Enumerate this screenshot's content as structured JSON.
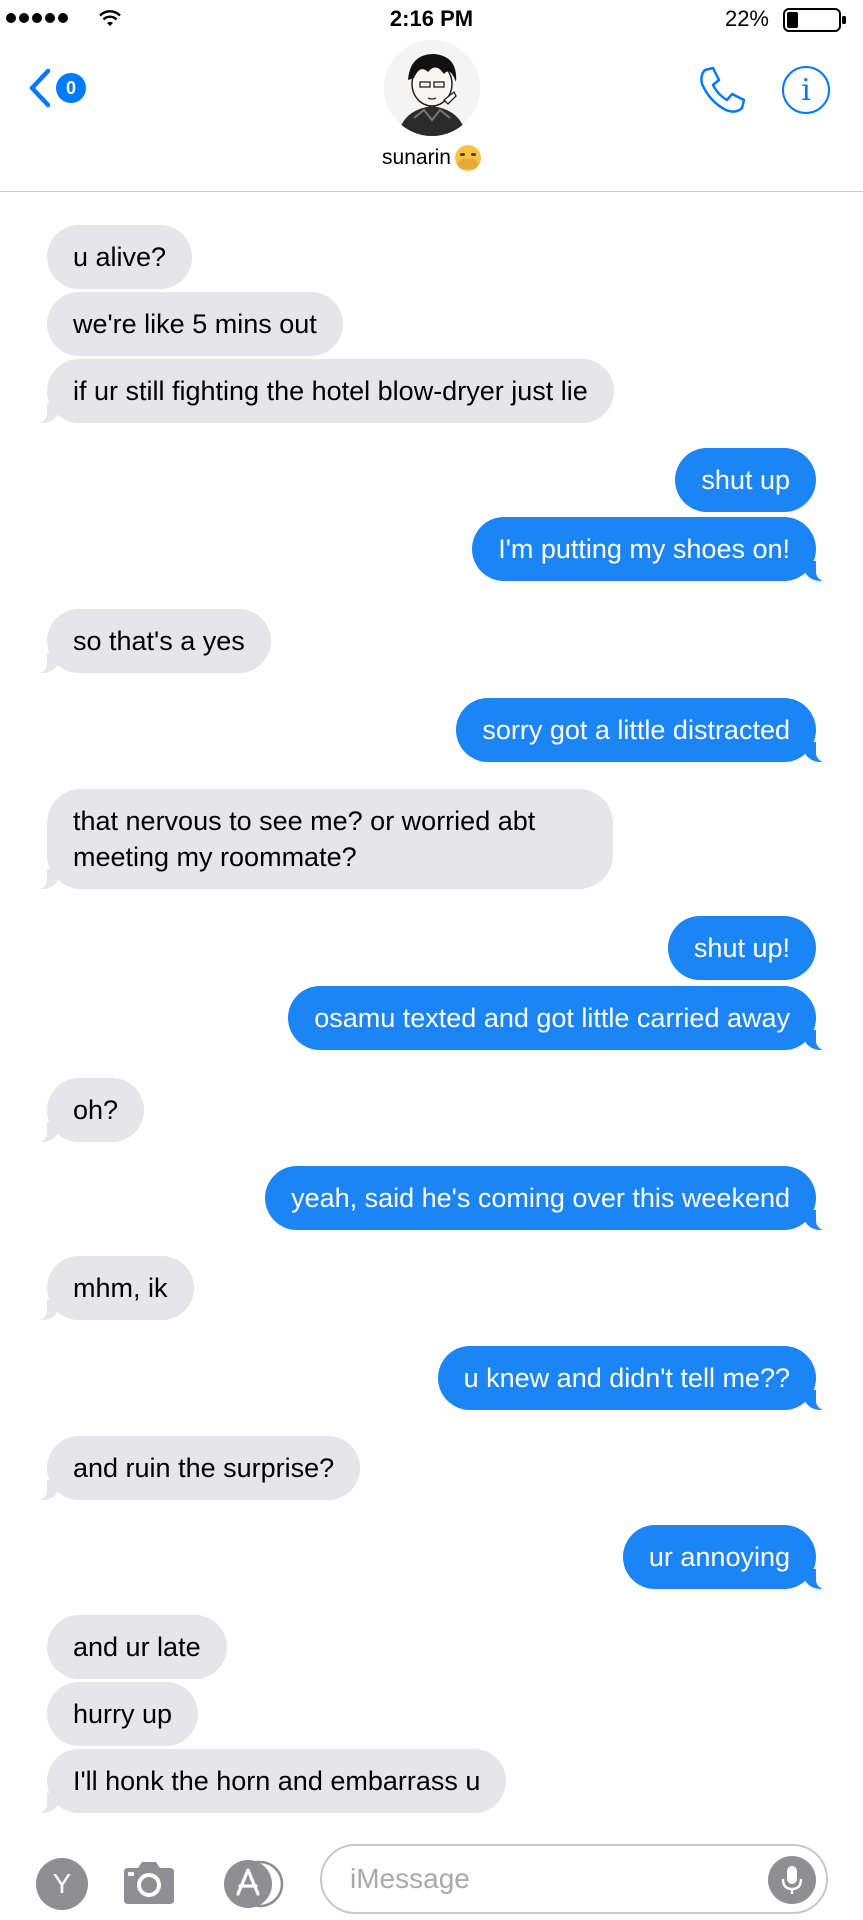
{
  "status_bar": {
    "time": "2:16 PM",
    "battery_percent": "22%",
    "icons": [
      "signal-dots-icon",
      "wifi-icon",
      "battery-icon"
    ]
  },
  "header": {
    "back_badge": "0",
    "contact_name": "sunarin",
    "contact_emoji": "shushing-face-emoji",
    "icons": [
      "chevron-left-icon",
      "avatar",
      "phone-icon",
      "info-icon"
    ]
  },
  "messages": [
    {
      "from": "contact",
      "text": "u alive?"
    },
    {
      "from": "contact",
      "text": "we're like 5 mins out"
    },
    {
      "from": "contact",
      "text": "if ur still fighting the hotel blow-dryer just lie"
    },
    {
      "from": "me",
      "text": "shut up"
    },
    {
      "from": "me",
      "text": "I'm putting my shoes on!"
    },
    {
      "from": "contact",
      "text": "so that's a yes"
    },
    {
      "from": "me",
      "text": "sorry got a little distracted"
    },
    {
      "from": "contact",
      "text": "that nervous to see me? or worried abt meeting my roommate?"
    },
    {
      "from": "me",
      "text": "shut up!"
    },
    {
      "from": "me",
      "text": "osamu texted and got little carried away"
    },
    {
      "from": "contact",
      "text": "oh?"
    },
    {
      "from": "me",
      "text": "yeah, said he's coming over this weekend"
    },
    {
      "from": "contact",
      "text": "mhm, ik"
    },
    {
      "from": "me",
      "text": "u knew and didn't tell me??"
    },
    {
      "from": "contact",
      "text": "and ruin the surprise?"
    },
    {
      "from": "me",
      "text": "ur annoying"
    },
    {
      "from": "contact",
      "text": "and ur late"
    },
    {
      "from": "contact",
      "text": "hurry up"
    },
    {
      "from": "contact",
      "text": "I'll honk the horn and embarrass u"
    }
  ],
  "input_bar": {
    "app_button_label": "Y",
    "placeholder": "iMessage",
    "value": "",
    "icons": [
      "camera-icon",
      "app-store-icon",
      "microphone-icon"
    ]
  },
  "colors": {
    "outgoing_bubble": "#1b85f6",
    "incoming_bubble": "#e5e5ea",
    "accent": "#007aff"
  }
}
